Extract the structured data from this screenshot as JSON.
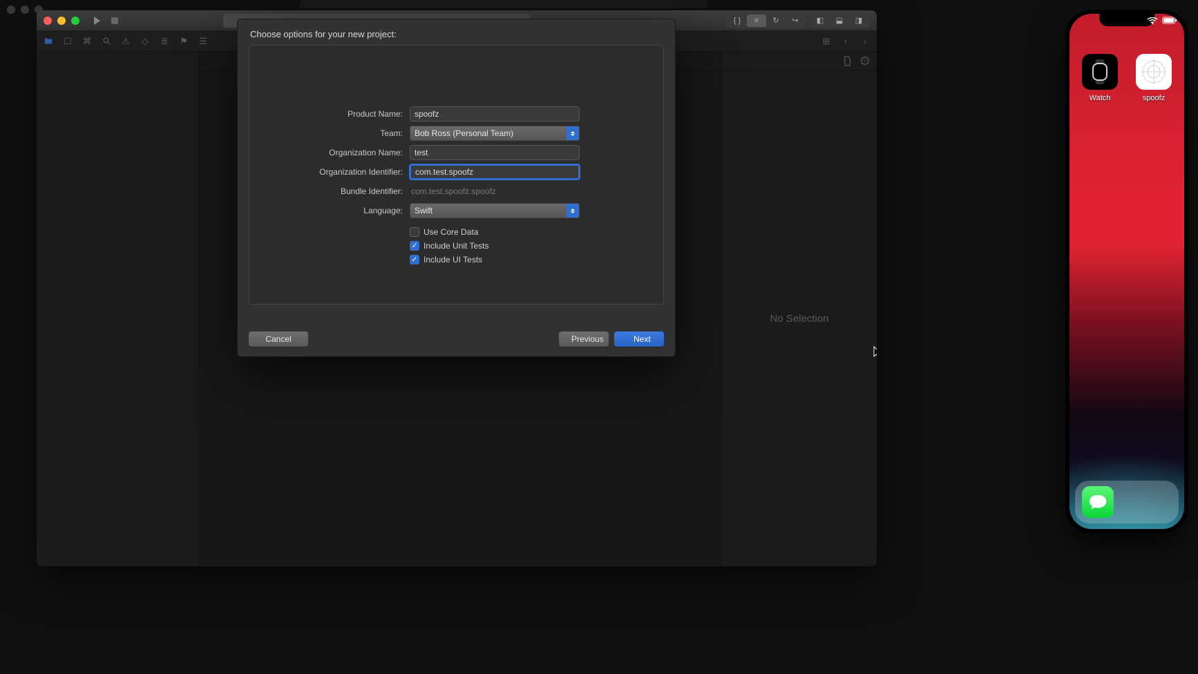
{
  "sheet": {
    "title": "Choose options for your new project:",
    "labels": {
      "product_name": "Product Name:",
      "team": "Team:",
      "org_name": "Organization Name:",
      "org_id": "Organization Identifier:",
      "bundle_id": "Bundle Identifier:",
      "language": "Language:"
    },
    "values": {
      "product_name": "spoofz",
      "team": "Bob Ross (Personal Team)",
      "org_name": "test",
      "org_id": "com.test.spoofz",
      "bundle_id": "com.test.spoofz.spoofz",
      "language": "Swift"
    },
    "checks": {
      "core_data_label": "Use Core Data",
      "core_data_checked": false,
      "unit_tests_label": "Include Unit Tests",
      "unit_tests_checked": true,
      "ui_tests_label": "Include UI Tests",
      "ui_tests_checked": true
    },
    "buttons": {
      "cancel": "Cancel",
      "previous": "Previous",
      "next": "Next"
    }
  },
  "inspector": {
    "no_selection": "No Selection"
  },
  "simulator": {
    "apps": {
      "watch": "Watch",
      "spoofz": "spoofz"
    }
  }
}
